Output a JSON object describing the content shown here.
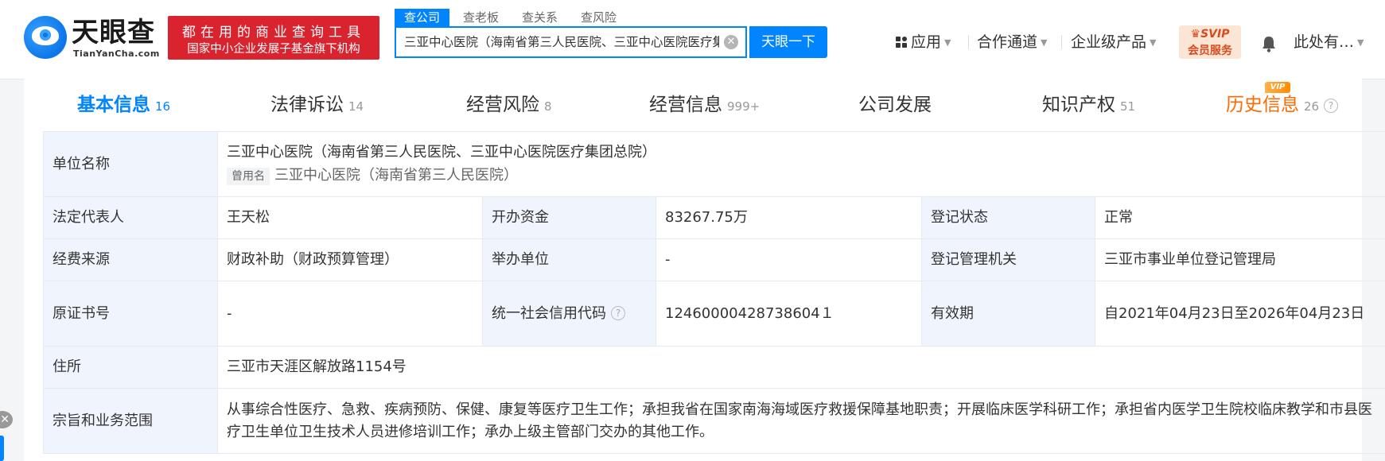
{
  "brand": {
    "name_cn": "天眼查",
    "name_en": "TianYanCha.com",
    "slogan_line1": "都在用的商业查询工具",
    "slogan_line2": "国家中小企业发展子基金旗下机构",
    "colors": {
      "brand_blue": "#0084ff",
      "slogan_red": "#d9232f",
      "history_orange": "#ff6a00"
    }
  },
  "search": {
    "tabs": [
      "查公司",
      "查老板",
      "查关系",
      "查风险"
    ],
    "active_tab": "查公司",
    "value": "三亚中心医院（海南省第三人民医院、三亚中心医院医疗集团总院）",
    "button": "天眼一下"
  },
  "nav": {
    "apps": "应用",
    "channel": "合作通道",
    "enterprise": "企业级产品",
    "svip_top": "SVIP",
    "svip_bottom": "会员服务",
    "user": "此处有…"
  },
  "tabs": [
    {
      "label": "基本信息",
      "count": "16"
    },
    {
      "label": "法律诉讼",
      "count": "14"
    },
    {
      "label": "经营风险",
      "count": "8"
    },
    {
      "label": "经营信息",
      "count": "999+"
    },
    {
      "label": "公司发展",
      "count": ""
    },
    {
      "label": "知识产权",
      "count": "51"
    },
    {
      "label": "历史信息",
      "count": "26"
    }
  ],
  "vip_badge": "VIP",
  "info": {
    "unit_name_label": "单位名称",
    "unit_name": "三亚中心医院（海南省第三人民医院、三亚中心医院医疗集团总院）",
    "used_name_tag": "曾用名",
    "used_name": "三亚中心医院（海南省第三人民医院）",
    "legal_rep_label": "法定代表人",
    "legal_rep": "王天松",
    "capital_label": "开办资金",
    "capital": "83267.75万",
    "reg_status_label": "登记状态",
    "reg_status": "正常",
    "fund_source_label": "经费来源",
    "fund_source": "财政补助（财政预算管理）",
    "organizer_label": "举办单位",
    "organizer": "-",
    "reg_authority_label": "登记管理机关",
    "reg_authority": "三亚市事业单位登记管理局",
    "cert_no_label": "原证书号",
    "cert_no": "-",
    "credit_code_label": "统一社会信用代码",
    "credit_code": "12460000428738604１",
    "validity_label": "有效期",
    "validity": "自2021年04月23日至2026年04月23日",
    "address_label": "住所",
    "address": "三亚市天涯区解放路1154号",
    "scope_label": "宗旨和业务范围",
    "scope": "从事综合性医疗、急救、疾病预防、保健、康复等医疗卫生工作；承担我省在国家南海海域医疗救援保障基地职责；开展临床医学科研工作；承担省内医学卫生院校临床教学和市县医疗卫生单位卫生技术人员进修培训工作；承办上级主管部门交办的其他工作。"
  }
}
